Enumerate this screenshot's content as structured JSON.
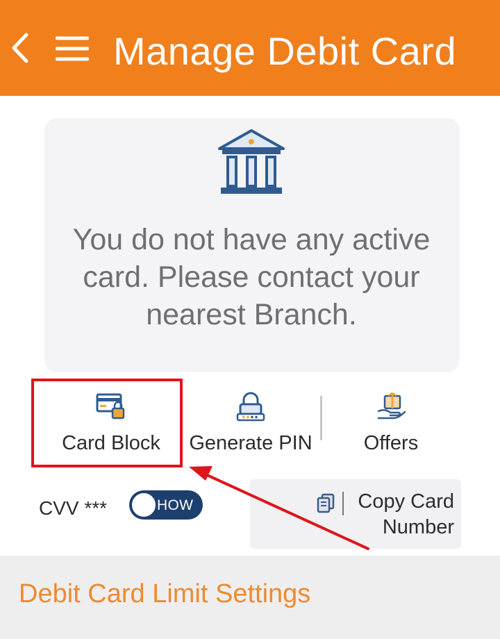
{
  "header": {
    "title": "Manage Debit Card",
    "back_icon": "chevron-left-icon",
    "menu_icon": "hamburger-menu-icon",
    "background_color": "#f07f1c"
  },
  "notice": {
    "icon": "bank-building-icon",
    "message": "You do not have any active card. Please contact your nearest Branch."
  },
  "actions": [
    {
      "label": "Card Block",
      "icon": "card-block-icon",
      "highlighted": true
    },
    {
      "label": "Generate PIN",
      "icon": "pin-lock-icon"
    },
    {
      "label": "Offers",
      "icon": "offers-gift-icon"
    }
  ],
  "cvv": {
    "label": "CVV ***",
    "toggle_text": "HOW"
  },
  "copy_card": {
    "icon": "copy-document-icon",
    "label": "Copy Card Number"
  },
  "limit_settings": {
    "title": "Debit Card Limit Settings"
  },
  "colors": {
    "accent": "#f07f1c",
    "highlight": "#e0141c",
    "toggle": "#1d3f6e",
    "icon_blue": "#2f5b8f"
  }
}
